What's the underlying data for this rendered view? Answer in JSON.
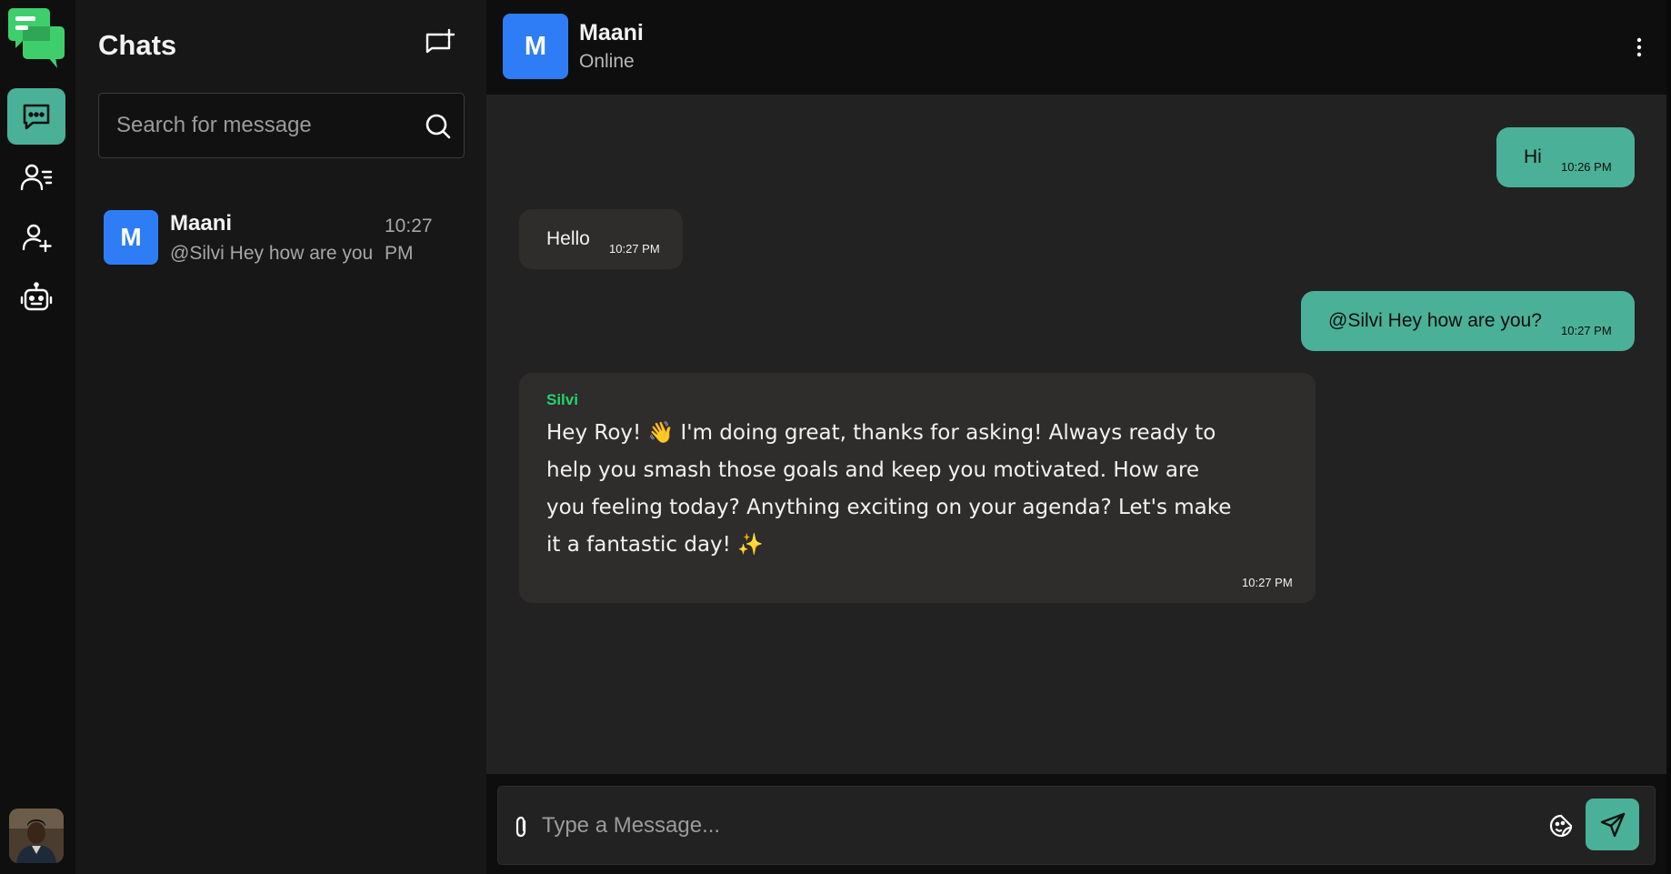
{
  "sidebar": {
    "items": [
      {
        "name": "chats",
        "active": true
      },
      {
        "name": "contacts",
        "active": false
      },
      {
        "name": "add-contact",
        "active": false
      },
      {
        "name": "bot",
        "active": false
      }
    ]
  },
  "chat_list": {
    "title": "Chats",
    "search_placeholder": "Search for message",
    "items": [
      {
        "initial": "M",
        "name": "Maani",
        "preview": "@Silvi Hey how are you",
        "time": "10:27 PM"
      }
    ]
  },
  "conversation": {
    "contact": {
      "initial": "M",
      "name": "Maani",
      "status": "Online"
    },
    "messages": [
      {
        "direction": "out",
        "text": "Hi",
        "time": "10:26 PM"
      },
      {
        "direction": "in",
        "text": "Hello",
        "time": "10:27 PM"
      },
      {
        "direction": "out",
        "text": "@Silvi Hey how are you?",
        "time": "10:27 PM"
      },
      {
        "direction": "in",
        "sender": "Silvi",
        "text": "Hey Roy! 👋 I'm doing great, thanks for asking! Always ready to help you smash those goals and keep you motivated. How are you feeling today? Anything exciting on your agenda? Let's make it a fantastic day! ✨",
        "time": "10:27 PM"
      }
    ]
  },
  "composer": {
    "placeholder": "Type a Message..."
  },
  "colors": {
    "accent": "#4ab198",
    "avatar": "#2f7df6",
    "sender": "#1fd66a",
    "panel": "#171717",
    "chat_bg": "#222222"
  }
}
